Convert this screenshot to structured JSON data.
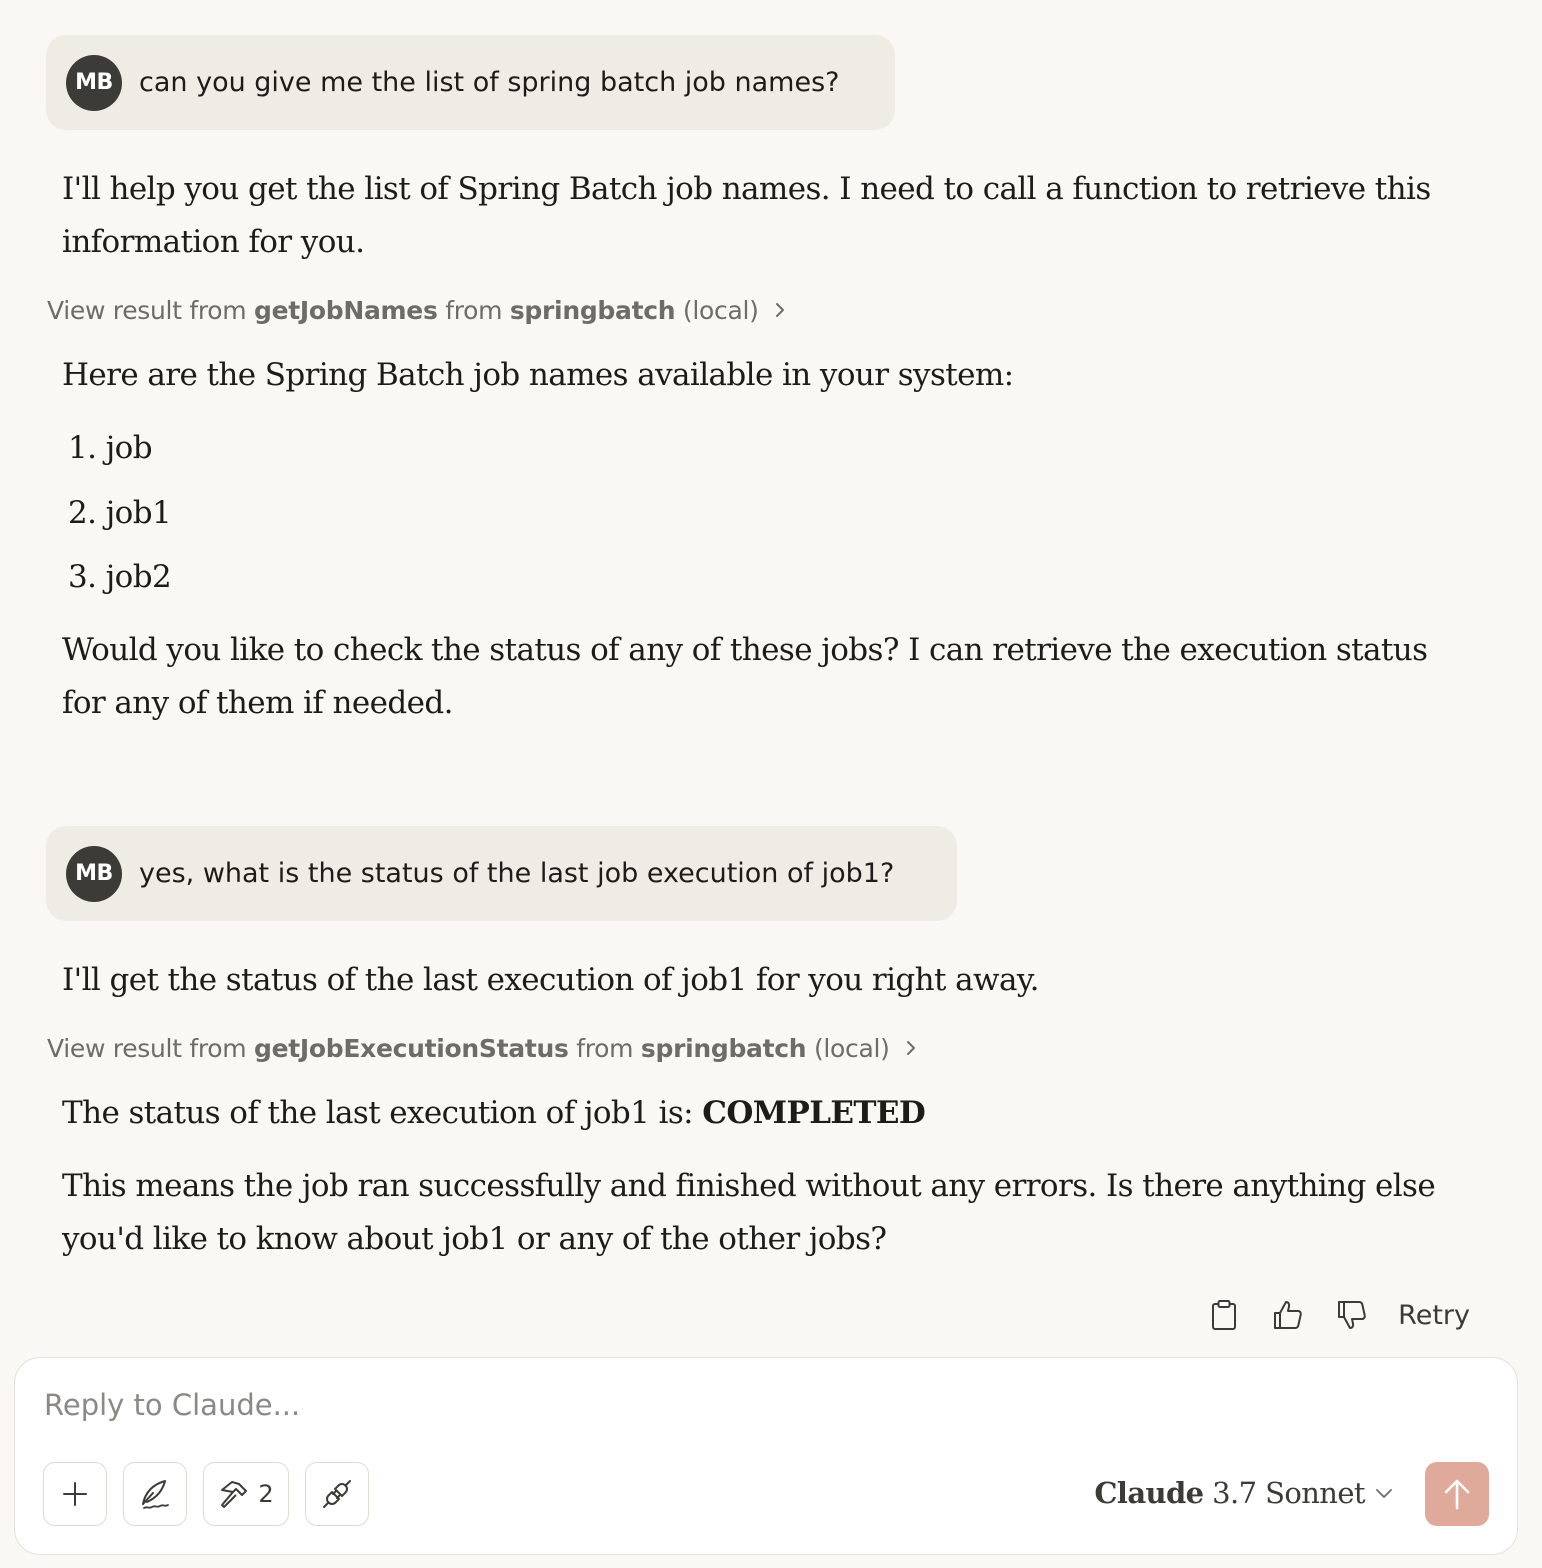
{
  "conversation": {
    "user_avatar_initials": "MB",
    "messages": [
      {
        "user": "can you give me the list of spring batch job names?"
      },
      {
        "user": "yes, what is the status of the last job execution of job1?"
      }
    ],
    "turn1": {
      "intro": "I'll help you get the list of Spring Batch job names. I need to call a function to retrieve this information for you.",
      "tool": {
        "prefix": "View result from",
        "name": "getJobNames",
        "mid": "from",
        "server": "springbatch",
        "suffix": "(local)"
      },
      "lead": "Here are the Spring Batch job names available in your system:",
      "jobs": [
        {
          "num": "1.",
          "name": "job"
        },
        {
          "num": "2.",
          "name": "job1"
        },
        {
          "num": "3.",
          "name": "job2"
        }
      ],
      "outro": "Would you like to check the status of any of these jobs? I can retrieve the execution status for any of them if needed."
    },
    "turn2": {
      "intro": "I'll get the status of the last execution of job1 for you right away.",
      "tool": {
        "prefix": "View result from",
        "name": "getJobExecutionStatus",
        "mid": "from",
        "server": "springbatch",
        "suffix": "(local)"
      },
      "status_prefix": "The status of the last execution of job1 is:",
      "status_value": "COMPLETED",
      "outro": "This means the job ran successfully and finished without any errors. Is there anything else you'd like to know about job1 or any of the other jobs?"
    }
  },
  "message_actions": {
    "retry_label": "Retry",
    "icons": [
      "clipboard-icon",
      "thumbs-up-icon",
      "thumbs-down-icon"
    ]
  },
  "composer": {
    "placeholder": "Reply to Claude...",
    "tools_count": "2",
    "model_brand": "Claude",
    "model_version": "3.7 Sonnet",
    "icons": [
      "plus-icon",
      "pen-nib-icon",
      "hammer-icon",
      "plug-icon",
      "arrow-up-icon",
      "chevron-down-icon"
    ],
    "send_color": "#e0aa9a"
  }
}
